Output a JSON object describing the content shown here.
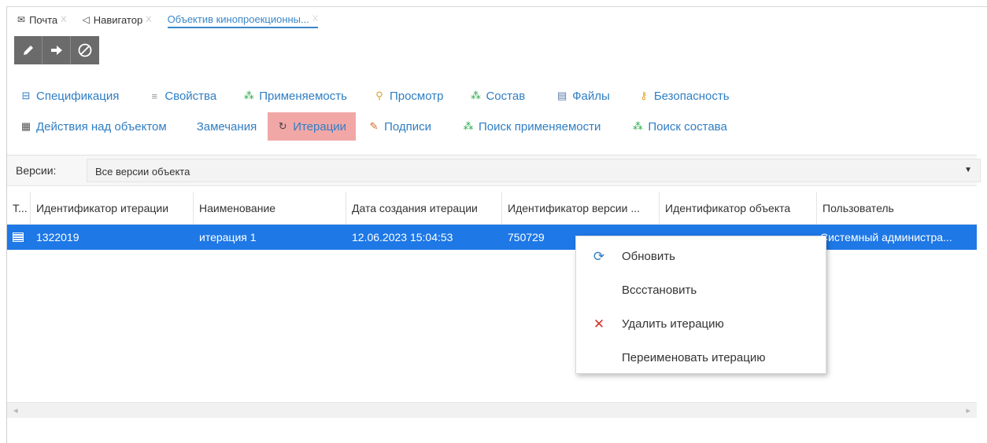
{
  "tabs": [
    {
      "label": "Почта",
      "icon": "mail-icon",
      "close": "X"
    },
    {
      "label": "Навигатор",
      "icon": "navigator-arrow-icon",
      "close": "X"
    },
    {
      "label": "Объектив кинопроекционны...",
      "close": "X"
    }
  ],
  "toolbar": [
    {
      "icon": "pencil-icon"
    },
    {
      "icon": "arrow-right-icon"
    },
    {
      "icon": "cancel-icon"
    }
  ],
  "links_row1": [
    {
      "label": "Спецификация",
      "icon": "spec-icon"
    },
    {
      "label": "Свойства",
      "icon": "properties-icon"
    },
    {
      "label": "Применяемость",
      "icon": "hierarchy-icon"
    },
    {
      "label": "Просмотр",
      "icon": "search-icon"
    },
    {
      "label": "Состав",
      "icon": "hierarchy-icon"
    },
    {
      "label": "Файлы",
      "icon": "file-icon"
    },
    {
      "label": "Безопасность",
      "icon": "key-icon"
    }
  ],
  "links_row2": [
    {
      "label": "Действия над объектом",
      "icon": "table-icon"
    },
    {
      "label": "Замечания"
    },
    {
      "label": "Итерации",
      "icon": "iterations-icon"
    },
    {
      "label": "Подписи",
      "icon": "signature-icon"
    },
    {
      "label": "Поиск применяемости",
      "icon": "hierarchy-icon"
    },
    {
      "label": "Поиск состава",
      "icon": "hierarchy-icon"
    }
  ],
  "versions": {
    "label": "Версии:",
    "value": "Все версии объекта",
    "arrow": "▼"
  },
  "grid": {
    "columns": [
      "Т...",
      "Идентификатор итерации",
      "Наименование",
      "Дата создания итерации",
      "Идентификатор версии ...",
      "Идентификатор объекта",
      "Пользователь"
    ],
    "rows": [
      [
        "1322019",
        "итерация 1",
        "12.06.2023 15:04:53",
        "750729",
        "",
        "Системный администра..."
      ]
    ]
  },
  "scroll": {
    "left": "◂",
    "right": "▸"
  },
  "context_menu": [
    {
      "label": "Обновить",
      "icon": "refresh-icon",
      "glyph": "⟳"
    },
    {
      "label": "Всcстановить"
    },
    {
      "label": "Удалить итерацию",
      "icon": "delete-x-icon",
      "glyph": "✕"
    },
    {
      "label": "Переименовать итерацию"
    }
  ],
  "colors": {
    "accent": "#2f7ec3",
    "selection": "#1e78e6",
    "highlight": "#f2a7a7",
    "toolbar": "#6b6b6b"
  }
}
